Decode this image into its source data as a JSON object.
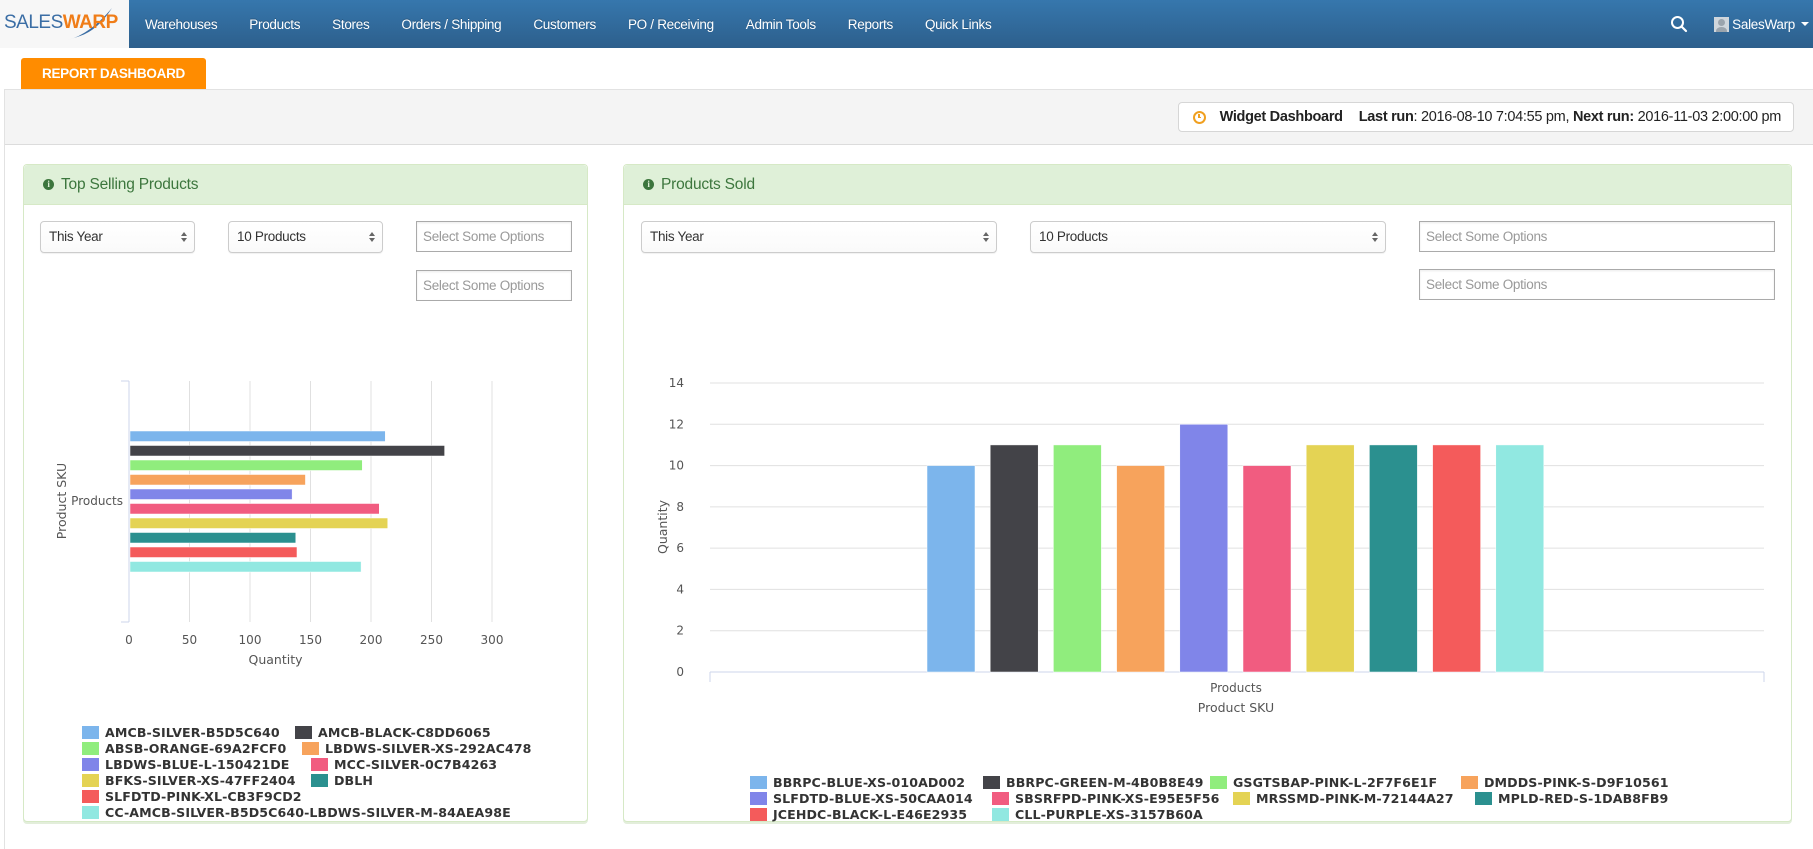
{
  "navbar": {
    "logo": {
      "part1": "SALES",
      "part2": "WARP"
    },
    "items": [
      {
        "label": "Warehouses"
      },
      {
        "label": "Products"
      },
      {
        "label": "Stores"
      },
      {
        "label": "Orders / Shipping"
      },
      {
        "label": "Customers"
      },
      {
        "label": "PO / Receiving"
      },
      {
        "label": "Admin Tools"
      },
      {
        "label": "Reports"
      },
      {
        "label": "Quick Links"
      }
    ],
    "search_icon": "search-icon",
    "user": {
      "name": "SalesWarp",
      "avatar_icon": "user-avatar-icon",
      "caret_icon": "caret-down-icon"
    }
  },
  "tab": {
    "label": "REPORT DASHBOARD"
  },
  "run_info": {
    "icon": "clock-icon",
    "title": "Widget Dashboard",
    "last_run_label": "Last run",
    "last_run_value": "2016-08-10 7:04:55 pm",
    "next_run_label": "Next run:",
    "next_run_value": "2016-11-03 2:00:00 pm"
  },
  "colors": {
    "series": [
      "#7cb5ec",
      "#434348",
      "#90ed7d",
      "#f7a35c",
      "#8085e9",
      "#f15c80",
      "#e4d354",
      "#2b908f",
      "#f45b5b",
      "#91e8e1"
    ],
    "navbar": "#3371a8",
    "tab": "#ff8c00",
    "panel_header": "#dff0d8",
    "panel_header_text": "#3c763d"
  },
  "widgets": {
    "top_selling": {
      "title": "Top Selling Products",
      "icon": "info-icon",
      "period_select": "This Year",
      "count_select": "10 Products",
      "filter1_placeholder": "Select Some Options",
      "filter2_placeholder": "Select Some Options"
    },
    "products_sold": {
      "title": "Products Sold",
      "icon": "info-icon",
      "period_select": "This Year",
      "count_select": "10 Products",
      "filter1_placeholder": "Select Some Options",
      "filter2_placeholder": "Select Some Options"
    }
  },
  "chart_data": [
    {
      "type": "bar",
      "orientation": "horizontal",
      "title": "Top Selling Products",
      "categories": [
        "Products"
      ],
      "xlabel": "Quantity",
      "ylabel": "Product SKU",
      "xlim": [
        0,
        300
      ],
      "xticks": [
        "0",
        "50",
        "100",
        "150",
        "200",
        "250",
        "300"
      ],
      "grid": true,
      "legend_position": "bottom",
      "series": [
        {
          "name": "AMCB-SILVER-B5D5C640",
          "values": [
            211
          ]
        },
        {
          "name": "AMCB-BLACK-C8DD6065",
          "values": [
            260
          ]
        },
        {
          "name": "ABSB-ORANGE-69A2FCF0",
          "values": [
            192
          ]
        },
        {
          "name": "LBDWS-SILVER-XS-292AC478",
          "values": [
            145
          ]
        },
        {
          "name": "LBDWS-BLUE-L-150421DE",
          "values": [
            134
          ]
        },
        {
          "name": "MCC-SILVER-0C7B4263",
          "values": [
            206
          ]
        },
        {
          "name": "BFKS-SILVER-XS-47FF2404",
          "values": [
            213
          ]
        },
        {
          "name": "DBLH",
          "values": [
            137
          ]
        },
        {
          "name": "SLFDTD-PINK-XL-CB3F9CD2",
          "values": [
            138
          ]
        },
        {
          "name": "CC-AMCB-SILVER-B5D5C640-LBDWS-SILVER-M-84AEA98E",
          "values": [
            191
          ]
        }
      ]
    },
    {
      "type": "bar",
      "orientation": "vertical",
      "title": "Products Sold",
      "categories": [
        "Products"
      ],
      "xlabel": "Product SKU",
      "ylabel": "Quantity",
      "ylim": [
        0,
        14
      ],
      "yticks": [
        "0",
        "2",
        "4",
        "6",
        "8",
        "10",
        "12",
        "14"
      ],
      "grid": true,
      "legend_position": "bottom",
      "series": [
        {
          "name": "BBRPC-BLUE-XS-010AD002",
          "values": [
            10
          ]
        },
        {
          "name": "BBRPC-GREEN-M-4B0B8E49",
          "values": [
            11
          ]
        },
        {
          "name": "GSGTSBAP-PINK-L-2F7F6E1F",
          "values": [
            11
          ]
        },
        {
          "name": "DMDDS-PINK-S-D9F10561",
          "values": [
            10
          ]
        },
        {
          "name": "SLFDTD-BLUE-XS-50CAA014",
          "values": [
            12
          ]
        },
        {
          "name": "SBSRFPD-PINK-XS-E95E5F56",
          "values": [
            10
          ]
        },
        {
          "name": "MRSSMD-PINK-M-72144A27",
          "values": [
            11
          ]
        },
        {
          "name": "MPLD-RED-S-1DAB8FB9",
          "values": [
            11
          ]
        },
        {
          "name": "JCEHDC-BLACK-L-E46E2935",
          "values": [
            11
          ]
        },
        {
          "name": "CLL-PURPLE-XS-3157B60A",
          "values": [
            11
          ]
        }
      ]
    }
  ]
}
